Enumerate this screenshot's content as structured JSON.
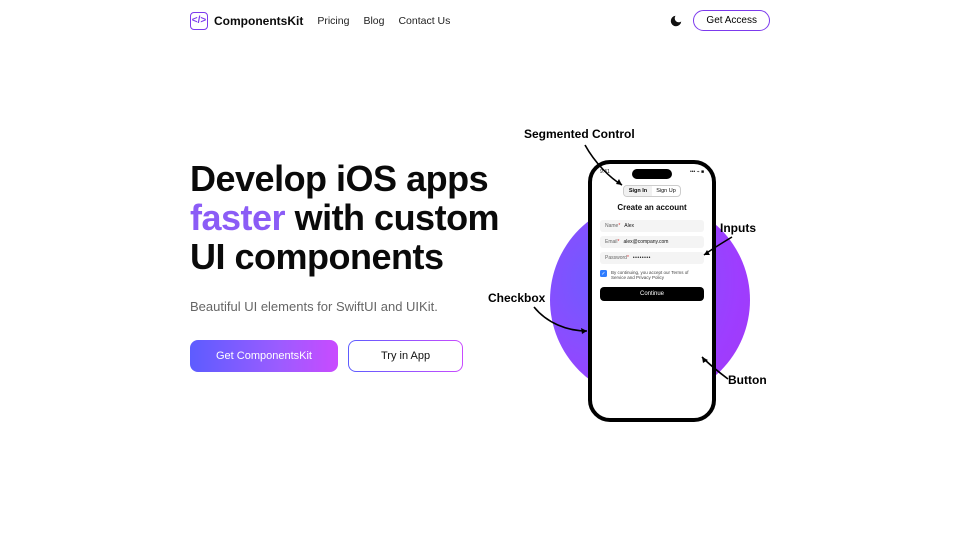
{
  "nav": {
    "brand": "ComponentsKit",
    "links": [
      "Pricing",
      "Blog",
      "Contact Us"
    ],
    "get_access": "Get Access"
  },
  "hero": {
    "h1_pre": "Develop iOS apps ",
    "h1_accent": "faster",
    "h1_post": " with custom UI components",
    "sub": "Beautiful UI elements for SwiftUI and UIKit.",
    "cta_primary": "Get ComponentsKit",
    "cta_secondary": "Try in App"
  },
  "phone": {
    "time": "9:41",
    "signal": "••• ⌁ ■",
    "seg_a": "Sign In",
    "seg_b": "Sign Up",
    "title": "Create an account",
    "f1_label": "Name",
    "f1_val": "Alex",
    "f2_label": "Email",
    "f2_val": "alex@company.com",
    "f3_label": "Password",
    "f3_val": "••••••••",
    "terms": "By continuing, you accept our Terms of Service and Privacy Policy",
    "continue": "Continue"
  },
  "anno": {
    "seg": "Segmented Control",
    "inputs": "Inputs",
    "checkbox": "Checkbox",
    "button": "Button"
  }
}
